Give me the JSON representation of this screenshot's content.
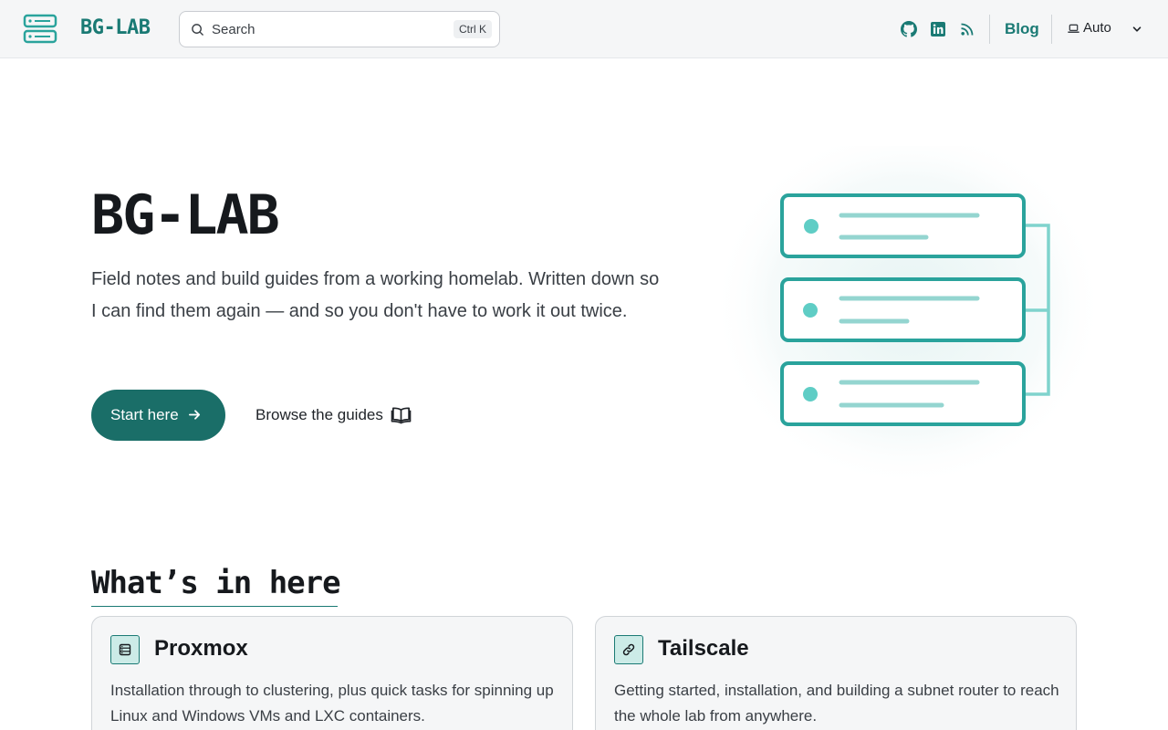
{
  "header": {
    "logo_text": "BG-LAB",
    "search_placeholder": "Search",
    "search_shortcut": "Ctrl K",
    "blog_label": "Blog",
    "theme_label": "Auto"
  },
  "hero": {
    "title": "BG-LAB",
    "subtitle": "Field notes and build guides from a working homelab. Written down so I can find them again — and so you don't have to work it out twice.",
    "primary_button": "Start here",
    "secondary_button": "Browse the guides"
  },
  "section": {
    "title": "What’s in here",
    "cards": [
      {
        "title": "Proxmox",
        "description": "Installation through to clustering, plus quick tasks for spinning up Linux and Windows VMs and LXC containers.",
        "icon": "server-icon"
      },
      {
        "title": "Tailscale",
        "description": "Getting started, installation, and building a subnet router to reach the whole lab from anywhere.",
        "icon": "link-icon"
      }
    ]
  },
  "colors": {
    "accent": "#1a7a74",
    "button": "#1a6e68",
    "illustration": "#2aa39c"
  }
}
